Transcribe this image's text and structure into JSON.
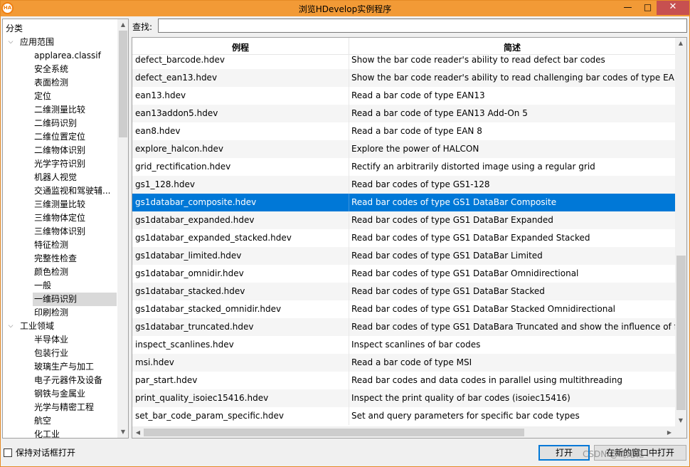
{
  "window": {
    "title": "浏览HDevelop实例程序",
    "icon_label": "HA",
    "controls": {
      "minimize": "—",
      "maximize": "□",
      "close": "✕"
    }
  },
  "tree": {
    "root_label": "分类",
    "nodes": [
      {
        "label": "应用范围",
        "level": 1,
        "expanded": true
      },
      {
        "label": "applarea.classif",
        "level": 2
      },
      {
        "label": "安全系统",
        "level": 2
      },
      {
        "label": "表面检测",
        "level": 2
      },
      {
        "label": "定位",
        "level": 2
      },
      {
        "label": "二维测量比较",
        "level": 2
      },
      {
        "label": "二维码识别",
        "level": 2
      },
      {
        "label": "二维位置定位",
        "level": 2
      },
      {
        "label": "二维物体识别",
        "level": 2
      },
      {
        "label": "光学字符识别",
        "level": 2
      },
      {
        "label": "机器人视觉",
        "level": 2
      },
      {
        "label": "交通监视和驾驶辅...",
        "level": 2
      },
      {
        "label": "三维测量比较",
        "level": 2
      },
      {
        "label": "三维物体定位",
        "level": 2
      },
      {
        "label": "三维物体识别",
        "level": 2
      },
      {
        "label": "特征检测",
        "level": 2
      },
      {
        "label": "完整性检查",
        "level": 2
      },
      {
        "label": "颜色检测",
        "level": 2
      },
      {
        "label": "一般",
        "level": 2
      },
      {
        "label": "一维码识别",
        "level": 2,
        "selected": true
      },
      {
        "label": "印刷检测",
        "level": 2
      },
      {
        "label": "工业领域",
        "level": 1,
        "expanded": true
      },
      {
        "label": "半导体业",
        "level": 2
      },
      {
        "label": "包装行业",
        "level": 2
      },
      {
        "label": "玻璃生产与加工",
        "level": 2
      },
      {
        "label": "电子元器件及设备",
        "level": 2
      },
      {
        "label": "钢铁与金属业",
        "level": 2
      },
      {
        "label": "光学与精密工程",
        "level": 2
      },
      {
        "label": "航空",
        "level": 2
      },
      {
        "label": "化工业",
        "level": 2
      }
    ]
  },
  "search": {
    "label": "查找:",
    "value": ""
  },
  "table": {
    "columns": {
      "name": "例程",
      "description": "简述"
    },
    "rows": [
      {
        "name": "defect_barcode.hdev",
        "desc": "Show the bar code reader's ability to read defect bar codes"
      },
      {
        "name": "defect_ean13.hdev",
        "desc": "Show the bar code reader's ability to read challenging bar codes of type EAN"
      },
      {
        "name": "ean13.hdev",
        "desc": "Read a bar code of type EAN13"
      },
      {
        "name": "ean13addon5.hdev",
        "desc": "Read a bar code of type EAN13 Add-On 5"
      },
      {
        "name": "ean8.hdev",
        "desc": "Read a bar code of type EAN 8"
      },
      {
        "name": "explore_halcon.hdev",
        "desc": "Explore the power of HALCON"
      },
      {
        "name": "grid_rectification.hdev",
        "desc": "Rectify an arbitrarily distorted image using a regular grid"
      },
      {
        "name": "gs1_128.hdev",
        "desc": "Read bar codes of type GS1-128"
      },
      {
        "name": "gs1databar_composite.hdev",
        "desc": "Read bar codes of type GS1 DataBar Composite",
        "selected": true
      },
      {
        "name": "gs1databar_expanded.hdev",
        "desc": "Read bar codes of type GS1 DataBar Expanded"
      },
      {
        "name": "gs1databar_expanded_stacked.hdev",
        "desc": "Read bar codes of type GS1 DataBar Expanded Stacked"
      },
      {
        "name": "gs1databar_limited.hdev",
        "desc": "Read bar codes of type GS1 DataBar Limited"
      },
      {
        "name": "gs1databar_omnidir.hdev",
        "desc": "Read bar codes of type GS1 DataBar Omnidirectional"
      },
      {
        "name": "gs1databar_stacked.hdev",
        "desc": "Read bar codes of type GS1 DataBar Stacked"
      },
      {
        "name": "gs1databar_stacked_omnidir.hdev",
        "desc": "Read bar codes of type GS1 DataBar Stacked Omnidirectional"
      },
      {
        "name": "gs1databar_truncated.hdev",
        "desc": "Read bar codes of type GS1 DataBara Truncated and show the influence of fa"
      },
      {
        "name": "inspect_scanlines.hdev",
        "desc": "Inspect scanlines of bar codes"
      },
      {
        "name": "msi.hdev",
        "desc": "Read a bar code of type MSI"
      },
      {
        "name": "par_start.hdev",
        "desc": "Read bar codes and data codes in parallel using multithreading"
      },
      {
        "name": "print_quality_isoiec15416.hdev",
        "desc": "Inspect the print quality of bar codes (isoiec15416)"
      },
      {
        "name": "set_bar_code_param_specific.hdev",
        "desc": "Set and query parameters for specific bar code types"
      }
    ]
  },
  "footer": {
    "keep_open_label": "保持对话框打开",
    "open_button": "打开",
    "open_new_button": "在新的窗口中打开",
    "watermark": "CSDN @鸢尾花"
  },
  "colors": {
    "title_bar": "#f29a36",
    "selection": "#0078d7",
    "close_button": "#c75050"
  }
}
